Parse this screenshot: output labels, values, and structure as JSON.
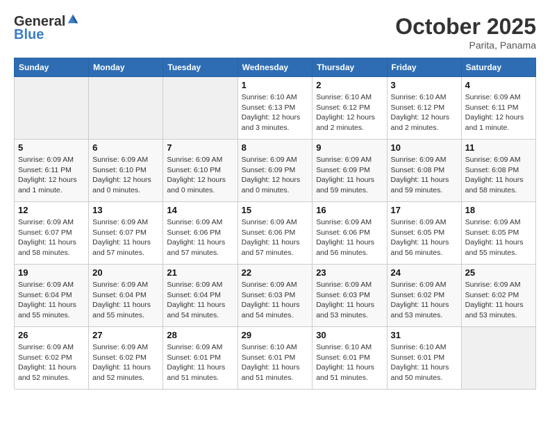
{
  "header": {
    "logo_line1": "General",
    "logo_line2": "Blue",
    "month": "October 2025",
    "location": "Parita, Panama"
  },
  "weekdays": [
    "Sunday",
    "Monday",
    "Tuesday",
    "Wednesday",
    "Thursday",
    "Friday",
    "Saturday"
  ],
  "weeks": [
    [
      {
        "day": "",
        "info": ""
      },
      {
        "day": "",
        "info": ""
      },
      {
        "day": "",
        "info": ""
      },
      {
        "day": "1",
        "info": "Sunrise: 6:10 AM\nSunset: 6:13 PM\nDaylight: 12 hours and 3 minutes."
      },
      {
        "day": "2",
        "info": "Sunrise: 6:10 AM\nSunset: 6:12 PM\nDaylight: 12 hours and 2 minutes."
      },
      {
        "day": "3",
        "info": "Sunrise: 6:10 AM\nSunset: 6:12 PM\nDaylight: 12 hours and 2 minutes."
      },
      {
        "day": "4",
        "info": "Sunrise: 6:09 AM\nSunset: 6:11 PM\nDaylight: 12 hours and 1 minute."
      }
    ],
    [
      {
        "day": "5",
        "info": "Sunrise: 6:09 AM\nSunset: 6:11 PM\nDaylight: 12 hours and 1 minute."
      },
      {
        "day": "6",
        "info": "Sunrise: 6:09 AM\nSunset: 6:10 PM\nDaylight: 12 hours and 0 minutes."
      },
      {
        "day": "7",
        "info": "Sunrise: 6:09 AM\nSunset: 6:10 PM\nDaylight: 12 hours and 0 minutes."
      },
      {
        "day": "8",
        "info": "Sunrise: 6:09 AM\nSunset: 6:09 PM\nDaylight: 12 hours and 0 minutes."
      },
      {
        "day": "9",
        "info": "Sunrise: 6:09 AM\nSunset: 6:09 PM\nDaylight: 11 hours and 59 minutes."
      },
      {
        "day": "10",
        "info": "Sunrise: 6:09 AM\nSunset: 6:08 PM\nDaylight: 11 hours and 59 minutes."
      },
      {
        "day": "11",
        "info": "Sunrise: 6:09 AM\nSunset: 6:08 PM\nDaylight: 11 hours and 58 minutes."
      }
    ],
    [
      {
        "day": "12",
        "info": "Sunrise: 6:09 AM\nSunset: 6:07 PM\nDaylight: 11 hours and 58 minutes."
      },
      {
        "day": "13",
        "info": "Sunrise: 6:09 AM\nSunset: 6:07 PM\nDaylight: 11 hours and 57 minutes."
      },
      {
        "day": "14",
        "info": "Sunrise: 6:09 AM\nSunset: 6:06 PM\nDaylight: 11 hours and 57 minutes."
      },
      {
        "day": "15",
        "info": "Sunrise: 6:09 AM\nSunset: 6:06 PM\nDaylight: 11 hours and 57 minutes."
      },
      {
        "day": "16",
        "info": "Sunrise: 6:09 AM\nSunset: 6:06 PM\nDaylight: 11 hours and 56 minutes."
      },
      {
        "day": "17",
        "info": "Sunrise: 6:09 AM\nSunset: 6:05 PM\nDaylight: 11 hours and 56 minutes."
      },
      {
        "day": "18",
        "info": "Sunrise: 6:09 AM\nSunset: 6:05 PM\nDaylight: 11 hours and 55 minutes."
      }
    ],
    [
      {
        "day": "19",
        "info": "Sunrise: 6:09 AM\nSunset: 6:04 PM\nDaylight: 11 hours and 55 minutes."
      },
      {
        "day": "20",
        "info": "Sunrise: 6:09 AM\nSunset: 6:04 PM\nDaylight: 11 hours and 55 minutes."
      },
      {
        "day": "21",
        "info": "Sunrise: 6:09 AM\nSunset: 6:04 PM\nDaylight: 11 hours and 54 minutes."
      },
      {
        "day": "22",
        "info": "Sunrise: 6:09 AM\nSunset: 6:03 PM\nDaylight: 11 hours and 54 minutes."
      },
      {
        "day": "23",
        "info": "Sunrise: 6:09 AM\nSunset: 6:03 PM\nDaylight: 11 hours and 53 minutes."
      },
      {
        "day": "24",
        "info": "Sunrise: 6:09 AM\nSunset: 6:02 PM\nDaylight: 11 hours and 53 minutes."
      },
      {
        "day": "25",
        "info": "Sunrise: 6:09 AM\nSunset: 6:02 PM\nDaylight: 11 hours and 53 minutes."
      }
    ],
    [
      {
        "day": "26",
        "info": "Sunrise: 6:09 AM\nSunset: 6:02 PM\nDaylight: 11 hours and 52 minutes."
      },
      {
        "day": "27",
        "info": "Sunrise: 6:09 AM\nSunset: 6:02 PM\nDaylight: 11 hours and 52 minutes."
      },
      {
        "day": "28",
        "info": "Sunrise: 6:09 AM\nSunset: 6:01 PM\nDaylight: 11 hours and 51 minutes."
      },
      {
        "day": "29",
        "info": "Sunrise: 6:10 AM\nSunset: 6:01 PM\nDaylight: 11 hours and 51 minutes."
      },
      {
        "day": "30",
        "info": "Sunrise: 6:10 AM\nSunset: 6:01 PM\nDaylight: 11 hours and 51 minutes."
      },
      {
        "day": "31",
        "info": "Sunrise: 6:10 AM\nSunset: 6:01 PM\nDaylight: 11 hours and 50 minutes."
      },
      {
        "day": "",
        "info": ""
      }
    ]
  ]
}
